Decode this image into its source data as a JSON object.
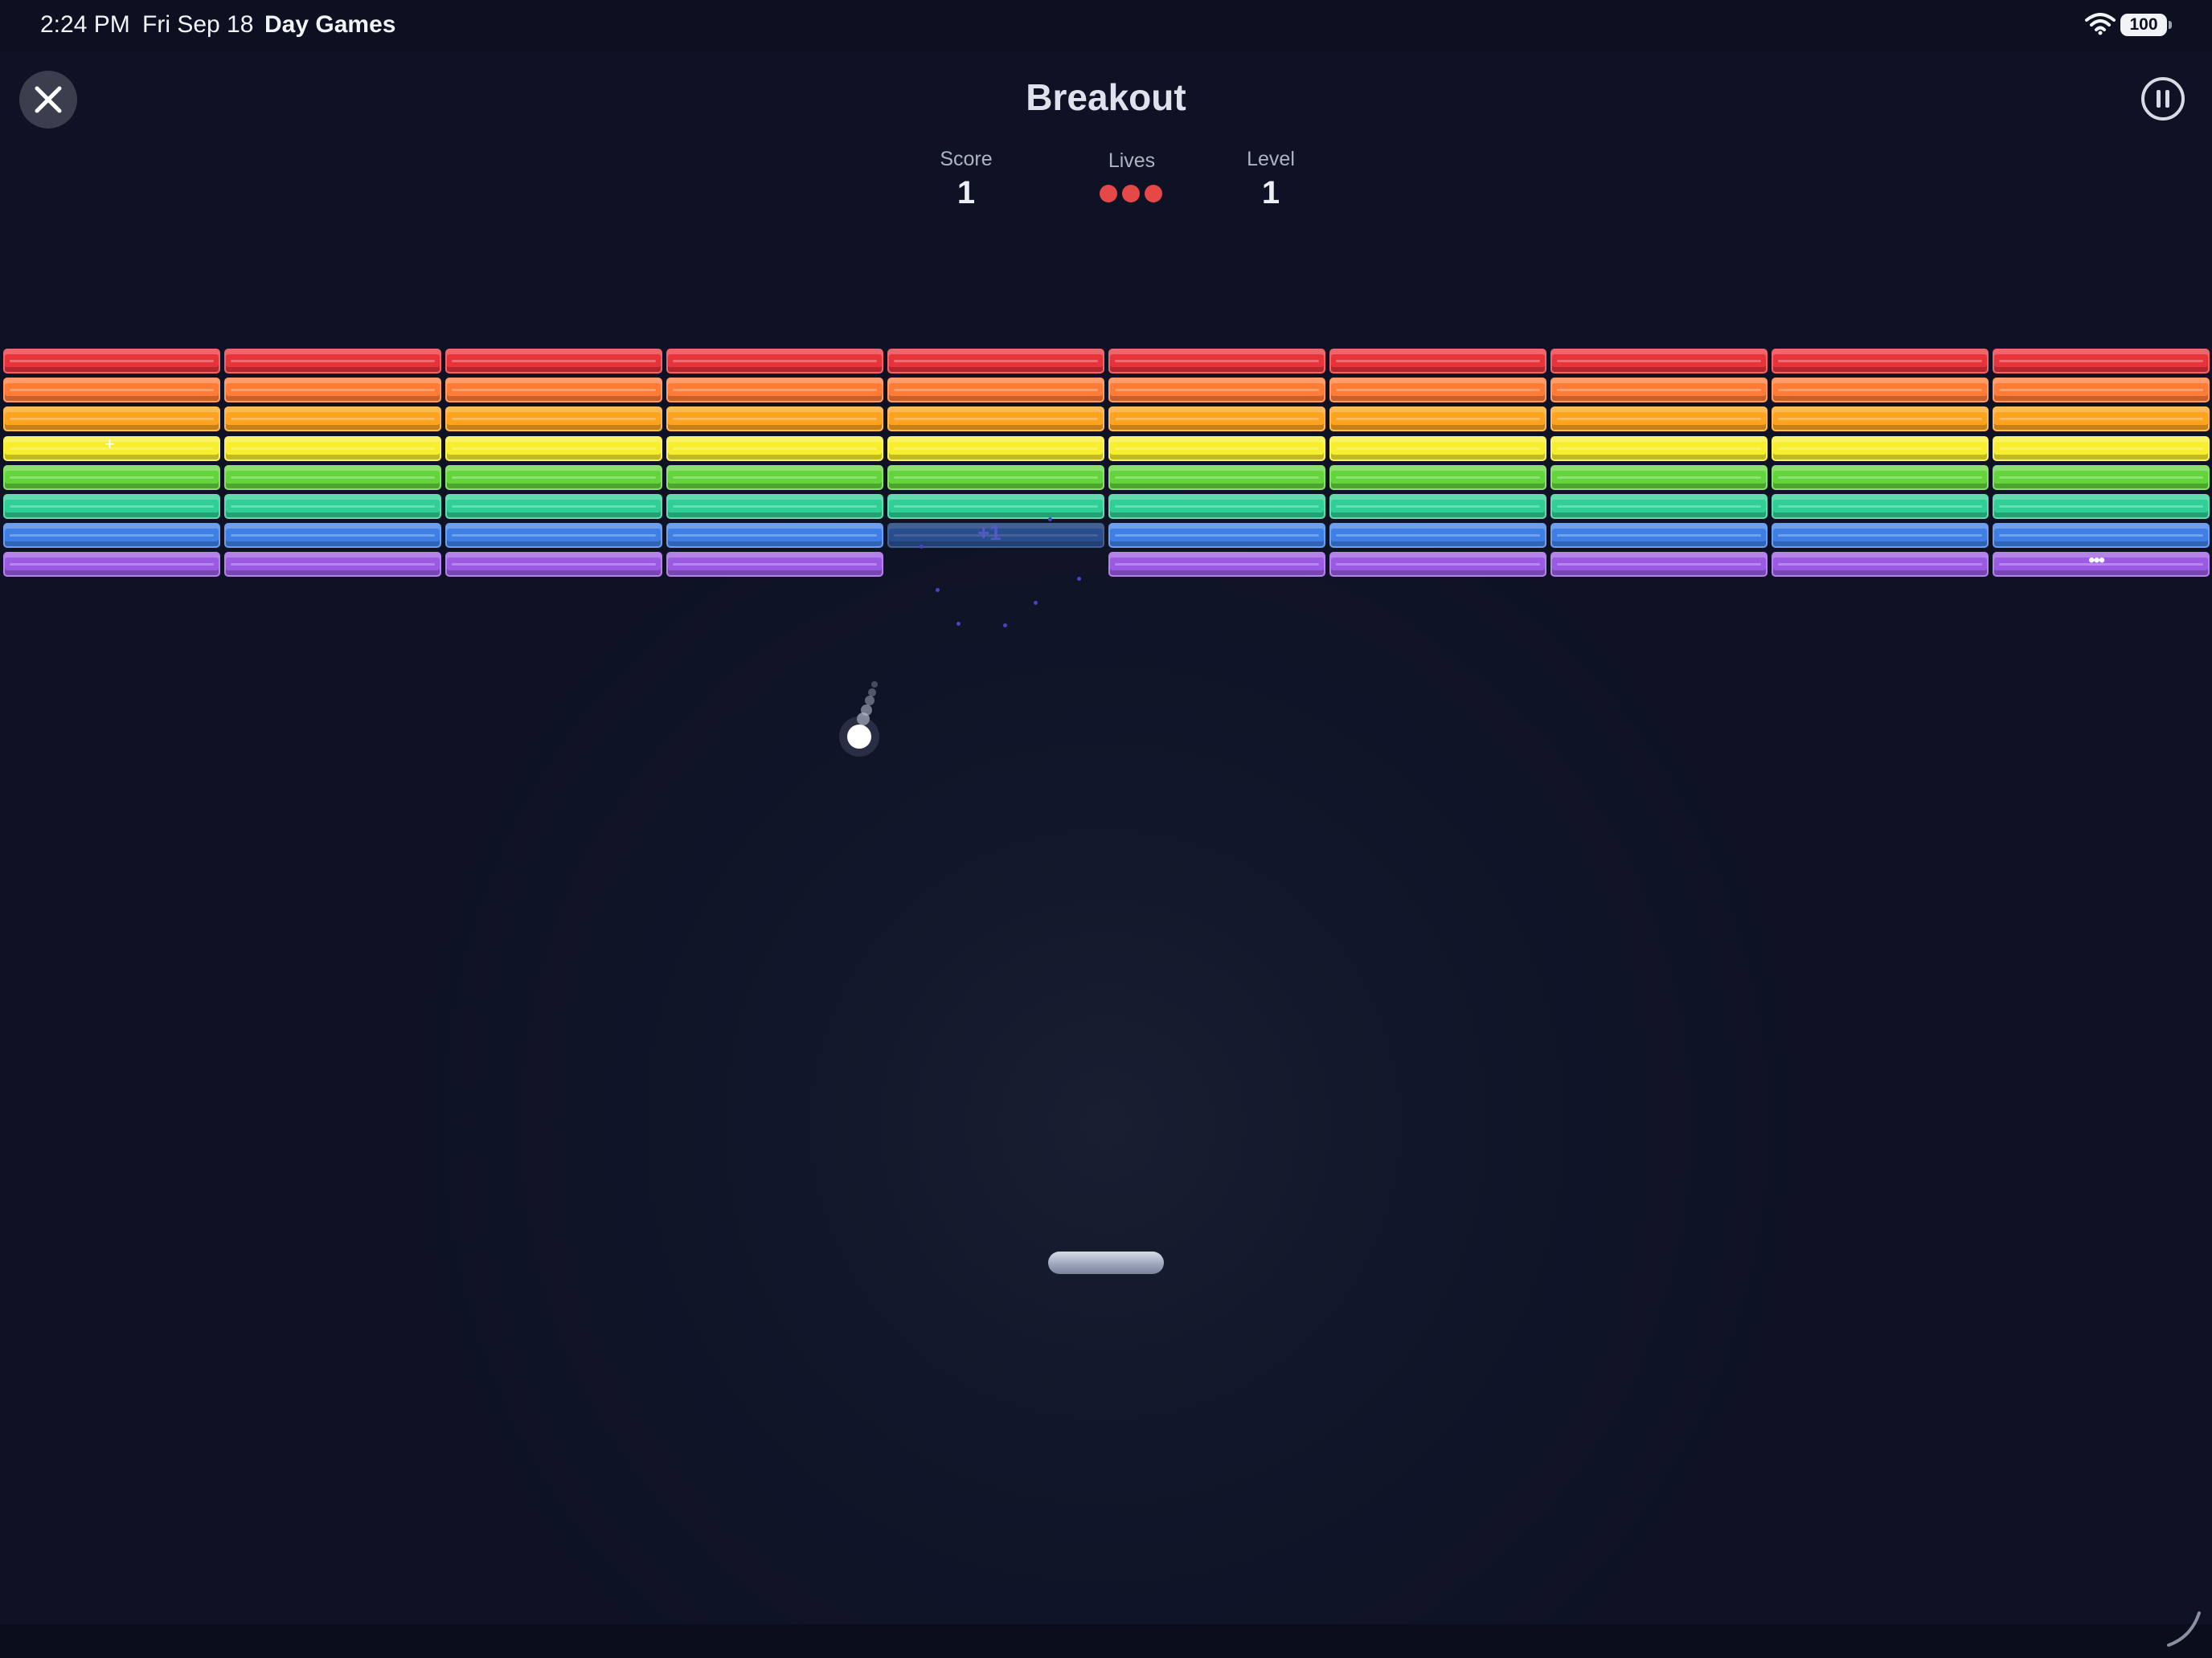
{
  "status_bar": {
    "time": "2:24 PM",
    "date": "Fri Sep 18",
    "app_name": "Day Games",
    "battery": "100"
  },
  "header": {
    "title": "Breakout",
    "close_icon": "close-icon",
    "pause_icon": "pause-icon"
  },
  "hud": {
    "score_label": "Score",
    "score_value": "1",
    "lives_label": "Lives",
    "lives_count": 3,
    "level_label": "Level",
    "level_value": "1"
  },
  "bricks": {
    "columns": 10,
    "row_colors": [
      "#e8333a",
      "#ff7b36",
      "#ffa31f",
      "#f7ee2e",
      "#64d43c",
      "#2fcf95",
      "#3e7fe6",
      "#9b5ae3"
    ],
    "removed": [
      [
        7,
        4
      ]
    ],
    "hit": [
      [
        6,
        4
      ]
    ]
  },
  "effects": {
    "popup_text": "+1",
    "spark_plus": "+",
    "spark_dots": "•••"
  },
  "colors": {
    "background": "#0f1325",
    "paddle": "#9aa3bb",
    "ball": "#ffffff",
    "life": "#e64848"
  }
}
